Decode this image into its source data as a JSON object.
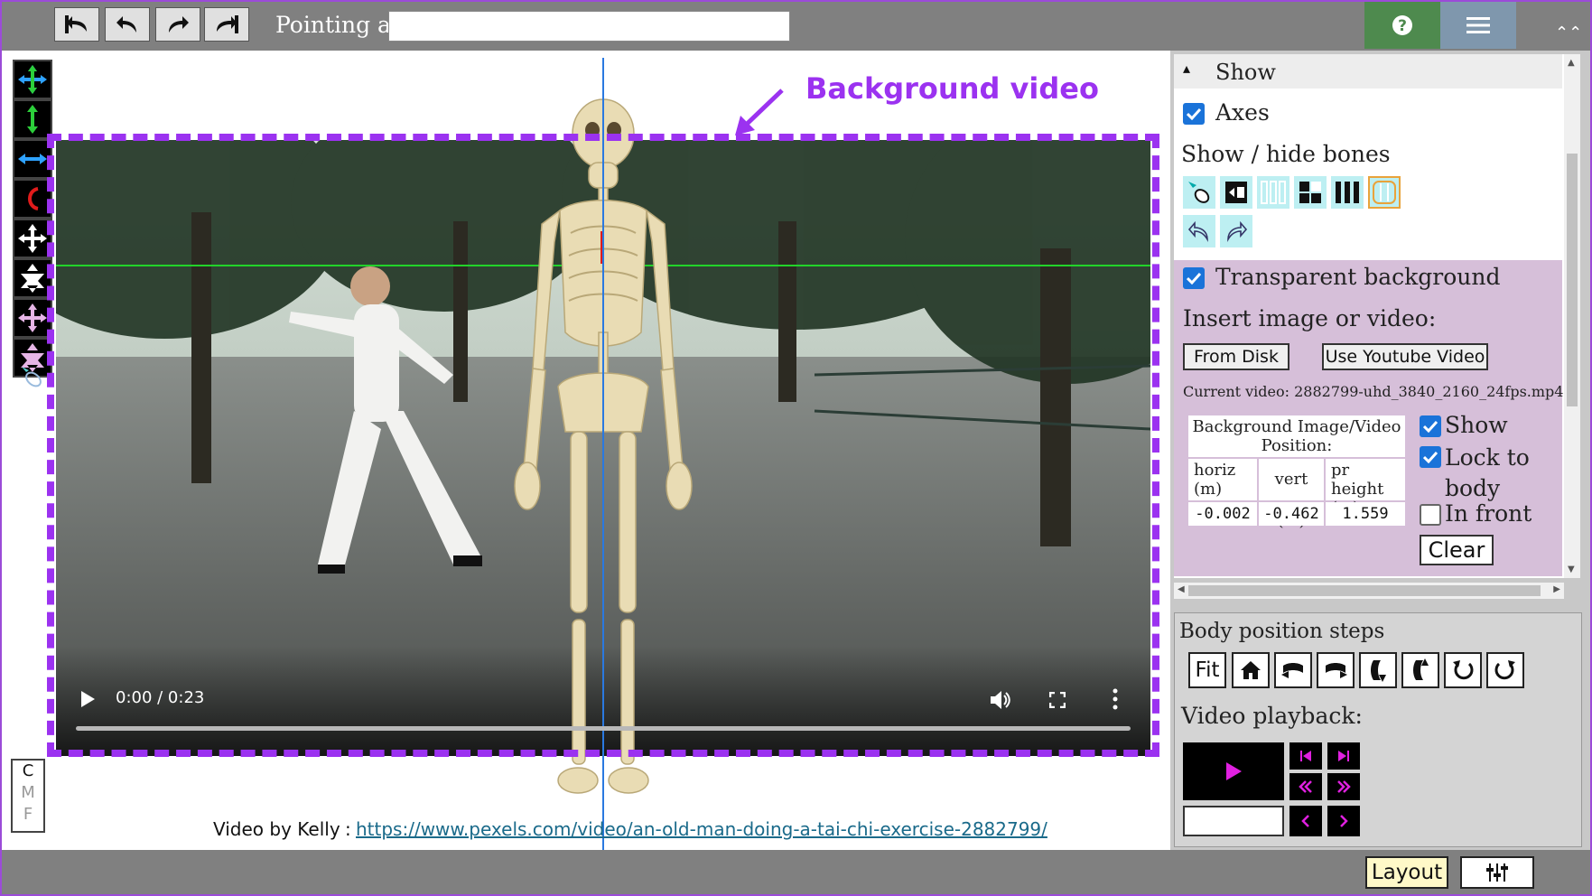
{
  "toolbar": {
    "pointing_label": "Pointing at:",
    "pointing_value": ""
  },
  "annotation": {
    "background_label": "Background video"
  },
  "video": {
    "time": "0:00 / 0:23",
    "progress": 0
  },
  "credit": {
    "text": "Video by Kelly",
    "sep": ":",
    "link": "https://www.pexels.com/video/an-old-man-doing-a-tai-chi-exercise-2882799/"
  },
  "cmf": [
    "C",
    "M",
    "F"
  ],
  "show_panel": {
    "header": "Show",
    "axes_label": "Axes",
    "axes_checked": true,
    "bones_label": "Show / hide bones",
    "transparent_label": "Transparent background",
    "transparent_checked": true,
    "insert_label": "Insert image or video:",
    "from_disk": "From Disk",
    "youtube": "Use Youtube Video",
    "current_video": "Current video: 2882799-uhd_3840_2160_24fps.mp4",
    "position_title": "Background Image/Video Position:",
    "col_horiz": "horiz (m)",
    "col_vert": "vert (m)",
    "col_height": "pr height (m)",
    "val_horiz": "-0.002",
    "val_vert": "-0.462",
    "val_height": "1.559",
    "show_label": "Show",
    "show_checked": true,
    "lock_label": "Lock to body",
    "lock_checked": true,
    "front_label": "In front",
    "front_checked": false,
    "clear": "Clear"
  },
  "steps": {
    "title": "Body position steps",
    "fit": "Fit",
    "playback_label": "Video playback:",
    "playback_field": ""
  },
  "bottom": {
    "layout": "Layout"
  },
  "colors": {
    "accent_purple": "#9b32f0",
    "help_green": "#4e8a4e",
    "menu_blue": "#7f97ad",
    "panel_purple": "#d6bfd9",
    "magenta": "#e020e0"
  }
}
